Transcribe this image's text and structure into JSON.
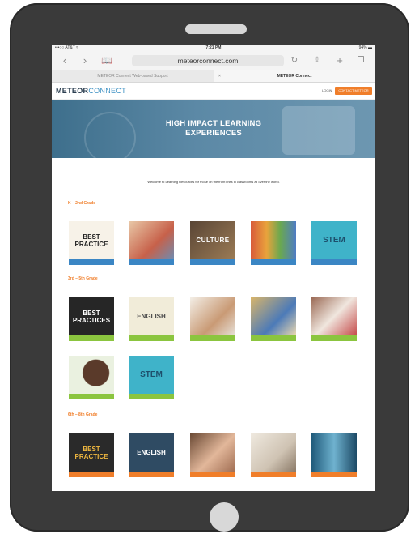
{
  "status_bar": {
    "carrier": "•••○○ AT&T ≈",
    "time": "7:21 PM",
    "battery": "94% ▬"
  },
  "browser": {
    "url": "meteorconnect.com",
    "tabs": [
      {
        "label": "METEOR Connect Web-based Support",
        "active": false
      },
      {
        "label": "METEOR Connect",
        "active": true
      }
    ],
    "icons": [
      "back-icon",
      "forward-icon",
      "bookmarks-icon",
      "reload-icon",
      "share-icon",
      "new-tab-icon",
      "tabs-icon"
    ]
  },
  "site": {
    "logo_meteor": "METEOR",
    "logo_connect": "CONNECT",
    "login": "LOGIN",
    "contact": "CONTACT METEOR",
    "hero_line1": "HIGH IMPACT LEARNING",
    "hero_line2": "EXPERIENCES",
    "welcome": "Welcome to Learning Resources for those on the front lines in classrooms all over the world."
  },
  "sections": [
    {
      "heading": "K – 2nd Grade",
      "cards": [
        {
          "thumb": "BEST PRACTICE",
          "caption": ""
        },
        {
          "thumb": "",
          "caption": ""
        },
        {
          "thumb": "CULTURE",
          "caption": ""
        },
        {
          "thumb": "",
          "caption": ""
        },
        {
          "thumb": "STEM",
          "caption": ""
        }
      ]
    },
    {
      "heading": "3rd – 5th Grade",
      "cards": [
        {
          "thumb": "BEST PRACTICES",
          "caption": ""
        },
        {
          "thumb": "ENGLISH",
          "caption": ""
        },
        {
          "thumb": "",
          "caption": ""
        },
        {
          "thumb": "",
          "caption": ""
        },
        {
          "thumb": "",
          "caption": ""
        },
        {
          "thumb": "",
          "caption": ""
        },
        {
          "thumb": "STEM",
          "caption": ""
        }
      ]
    },
    {
      "heading": "6th – 8th Grade",
      "cards": [
        {
          "thumb": "BEST PRACTICE",
          "caption": ""
        },
        {
          "thumb": "ENGLISH",
          "caption": ""
        },
        {
          "thumb": "",
          "caption": ""
        },
        {
          "thumb": "",
          "caption": ""
        },
        {
          "thumb": "",
          "caption": ""
        }
      ]
    }
  ],
  "colors": {
    "accent": "#f07e2a",
    "brand_blue": "#3f92c4",
    "caption_blue": "#3b86c4",
    "caption_green": "#8bc53f"
  }
}
